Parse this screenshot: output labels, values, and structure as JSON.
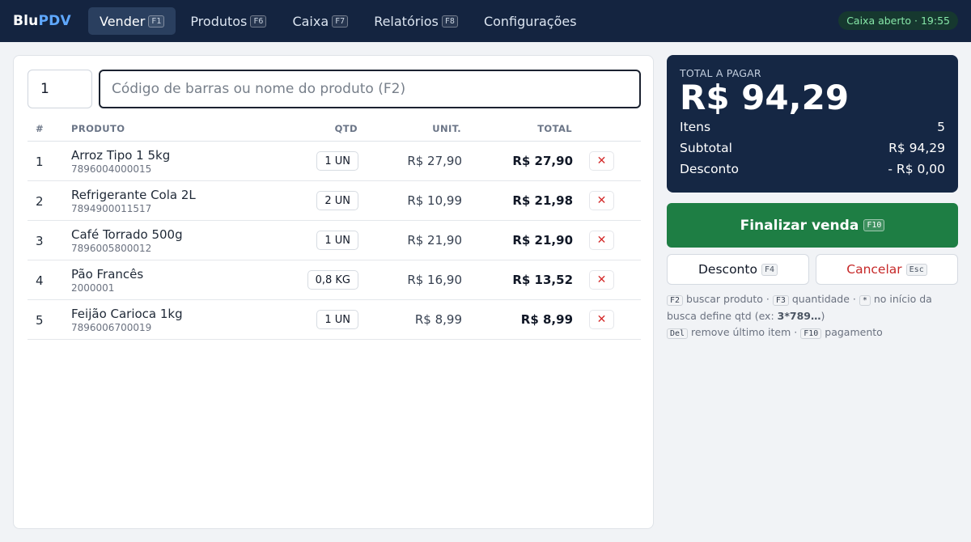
{
  "app": {
    "logo_main": "Blu",
    "logo_accent": "PDV"
  },
  "nav": [
    {
      "label": "Vender",
      "key": "F1",
      "active": true
    },
    {
      "label": "Produtos",
      "key": "F6"
    },
    {
      "label": "Caixa",
      "key": "F7"
    },
    {
      "label": "Relatórios",
      "key": "F8"
    },
    {
      "label": "Configurações"
    }
  ],
  "status": {
    "text": "Caixa aberto · 19:55"
  },
  "entry": {
    "qty_value": "1",
    "search_placeholder": "Código de barras ou nome do produto (F2)"
  },
  "table": {
    "headers": {
      "num": "#",
      "product": "PRODUTO",
      "qty": "QTD",
      "unit": "UNIT.",
      "total": "TOTAL"
    },
    "rows": [
      {
        "num": "1",
        "name": "Arroz Tipo 1 5kg",
        "code": "7896004000015",
        "qty": "1 UN",
        "unit": "R$ 27,90",
        "total": "R$ 27,90",
        "remove": "✕"
      },
      {
        "num": "2",
        "name": "Refrigerante Cola 2L",
        "code": "7894900011517",
        "qty": "2 UN",
        "unit": "R$ 10,99",
        "total": "R$ 21,98",
        "remove": "✕"
      },
      {
        "num": "3",
        "name": "Café Torrado 500g",
        "code": "7896005800012",
        "qty": "1 UN",
        "unit": "R$ 21,90",
        "total": "R$ 21,90",
        "remove": "✕"
      },
      {
        "num": "4",
        "name": "Pão Francês",
        "code": "2000001",
        "qty": "0,8 KG",
        "unit": "R$ 16,90",
        "total": "R$ 13,52",
        "remove": "✕"
      },
      {
        "num": "5",
        "name": "Feijão Carioca 1kg",
        "code": "7896006700019",
        "qty": "1 UN",
        "unit": "R$ 8,99",
        "total": "R$ 8,99",
        "remove": "✕"
      }
    ]
  },
  "summary": {
    "label": "TOTAL A PAGAR",
    "value": "R$ 94,29",
    "items_label": "Itens",
    "items_value": "5",
    "subtotal_label": "Subtotal",
    "subtotal_value": "R$ 94,29",
    "discount_label": "Desconto",
    "discount_value": "- R$ 0,00"
  },
  "actions": {
    "finish_label": "Finalizar venda",
    "finish_key": "F10",
    "discount_label": "Desconto",
    "discount_key": "F4",
    "cancel_label": "Cancelar",
    "cancel_key": "Esc"
  },
  "hints": {
    "k1": "F2",
    "t1": "buscar produto ·",
    "k2": "F3",
    "t2": "quantidade ·",
    "k3": "*",
    "t3": "no início da busca define qtd (ex:",
    "example": "3*789…",
    "t3b": ")",
    "k4": "Del",
    "t4": "remove último item ·",
    "k5": "F10",
    "t5": "pagamento"
  },
  "colors": {
    "nav_bg": "#142440",
    "accent": "#5fa8ff",
    "finish_green": "#1e7e44",
    "cancel_red": "#d42b2b",
    "summary_bg": "#152744"
  }
}
